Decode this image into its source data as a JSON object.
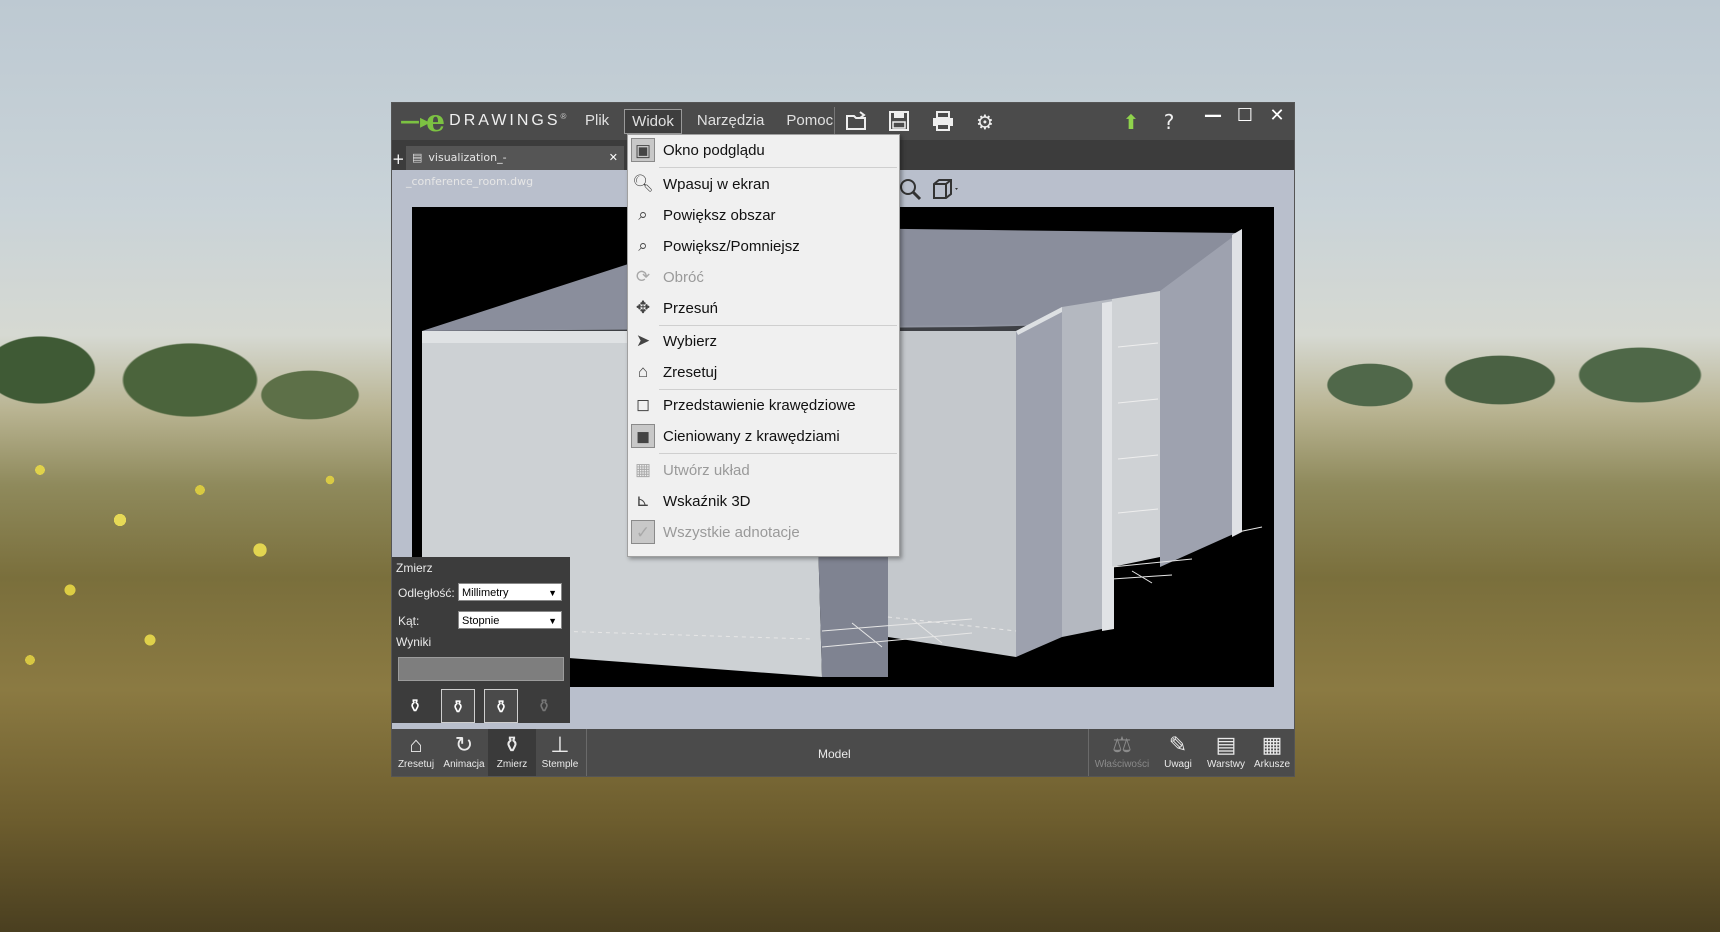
{
  "app": {
    "logo_mark": "e",
    "logo_text": "DRAWINGS",
    "logo_reg": "®"
  },
  "menu": [
    "Plik",
    "Widok",
    "Narzędzia",
    "Pomoc"
  ],
  "tab": {
    "filename": "visualization_-_conference_room.dwg",
    "close": "✕",
    "plus": "+"
  },
  "dropdown": {
    "items": [
      {
        "label": "Okno podglądu",
        "icon": "preview-window-icon",
        "enabled": true
      },
      {
        "label": "Wpasuj w ekran",
        "icon": "zoom-fit-icon",
        "enabled": true
      },
      {
        "label": "Powiększ obszar",
        "icon": "zoom-area-icon",
        "enabled": true
      },
      {
        "label": "Powiększ/Pomniejsz",
        "icon": "zoom-in-out-icon",
        "enabled": true
      },
      {
        "label": "Obróć",
        "icon": "rotate-icon",
        "enabled": false
      },
      {
        "label": "Przesuń",
        "icon": "pan-icon",
        "enabled": true
      },
      {
        "label": "Wybierz",
        "icon": "select-arrow-icon",
        "enabled": true
      },
      {
        "label": "Zresetuj",
        "icon": "home-icon",
        "enabled": true
      },
      {
        "label": "Przedstawienie krawędziowe",
        "icon": "wireframe-cube-icon",
        "enabled": true
      },
      {
        "label": "Cieniowany z krawędziami",
        "icon": "shaded-cube-icon",
        "enabled": true
      },
      {
        "label": "Utwórz układ",
        "icon": "create-layout-icon",
        "enabled": false
      },
      {
        "label": "Wskaźnik 3D",
        "icon": "3d-pointer-icon",
        "enabled": true
      },
      {
        "label": "Wszystkie adnotacje",
        "icon": "checkmark-icon",
        "enabled": false
      }
    ]
  },
  "measure": {
    "title": "Zmierz",
    "distance_label": "Odległość:",
    "distance_value": "Millimetry",
    "angle_label": "Kąt:",
    "angle_value": "Stopnie",
    "results_label": "Wyniki"
  },
  "bottom": {
    "left_buttons": [
      {
        "label": "Zresetuj",
        "icon": "home-icon"
      },
      {
        "label": "Animacja",
        "icon": "animation-icon"
      },
      {
        "label": "Zmierz",
        "icon": "measure-icon"
      },
      {
        "label": "Stemple",
        "icon": "stamp-icon"
      }
    ],
    "center_label": "Model",
    "right_buttons": [
      {
        "label": "Właściwości",
        "icon": "properties-scale-icon",
        "enabled": false
      },
      {
        "label": "Uwagi",
        "icon": "pencil-icon",
        "enabled": true
      },
      {
        "label": "Warstwy",
        "icon": "layers-icon",
        "enabled": true
      },
      {
        "label": "Arkusze",
        "icon": "sheets-icon",
        "enabled": true
      }
    ]
  }
}
